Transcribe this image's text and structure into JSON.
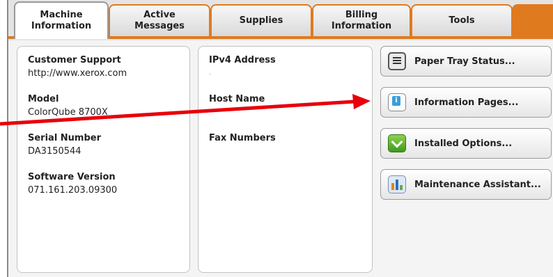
{
  "tabs": [
    {
      "label": "Machine\nInformation",
      "active": true
    },
    {
      "label": "Active\nMessages",
      "active": false
    },
    {
      "label": "Supplies",
      "active": false
    },
    {
      "label": "Billing\nInformation",
      "active": false
    },
    {
      "label": "Tools",
      "active": false
    }
  ],
  "machine_info": {
    "customer_support_label": "Customer Support",
    "customer_support_value": "http://www.xerox.com",
    "model_label": "Model",
    "model_value": "ColorQube 8700X",
    "serial_label": "Serial Number",
    "serial_value": "DA3150544",
    "software_label": "Software Version",
    "software_value": "071.161.203.09300"
  },
  "network_info": {
    "ipv4_label": "IPv4 Address",
    "ipv4_value": "-",
    "host_label": "Host Name",
    "fax_label": "Fax Numbers"
  },
  "buttons": [
    {
      "label": "Paper Tray Status...",
      "icon": "paper-tray-icon"
    },
    {
      "label": "Information Pages...",
      "icon": "information-pages-icon"
    },
    {
      "label": "Installed Options...",
      "icon": "installed-options-icon"
    },
    {
      "label": "Maintenance Assistant...",
      "icon": "maintenance-assistant-icon"
    }
  ],
  "colors": {
    "tab_accent": "#e07a1f",
    "annotation_arrow": "#e8000b"
  }
}
